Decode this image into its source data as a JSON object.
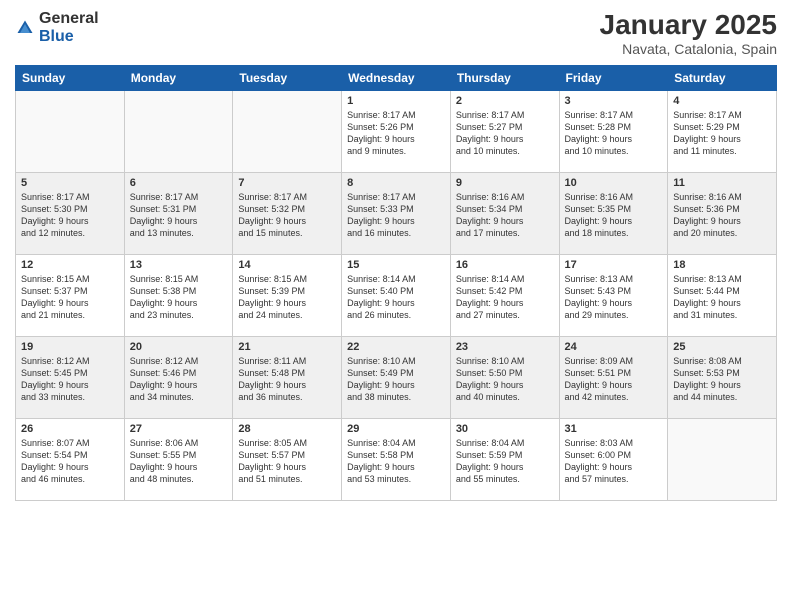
{
  "logo": {
    "general": "General",
    "blue": "Blue"
  },
  "title": "January 2025",
  "location": "Navata, Catalonia, Spain",
  "days_of_week": [
    "Sunday",
    "Monday",
    "Tuesday",
    "Wednesday",
    "Thursday",
    "Friday",
    "Saturday"
  ],
  "weeks": [
    {
      "shaded": false,
      "days": [
        {
          "num": "",
          "lines": []
        },
        {
          "num": "",
          "lines": []
        },
        {
          "num": "",
          "lines": []
        },
        {
          "num": "1",
          "lines": [
            "Sunrise: 8:17 AM",
            "Sunset: 5:26 PM",
            "Daylight: 9 hours",
            "and 9 minutes."
          ]
        },
        {
          "num": "2",
          "lines": [
            "Sunrise: 8:17 AM",
            "Sunset: 5:27 PM",
            "Daylight: 9 hours",
            "and 10 minutes."
          ]
        },
        {
          "num": "3",
          "lines": [
            "Sunrise: 8:17 AM",
            "Sunset: 5:28 PM",
            "Daylight: 9 hours",
            "and 10 minutes."
          ]
        },
        {
          "num": "4",
          "lines": [
            "Sunrise: 8:17 AM",
            "Sunset: 5:29 PM",
            "Daylight: 9 hours",
            "and 11 minutes."
          ]
        }
      ]
    },
    {
      "shaded": true,
      "days": [
        {
          "num": "5",
          "lines": [
            "Sunrise: 8:17 AM",
            "Sunset: 5:30 PM",
            "Daylight: 9 hours",
            "and 12 minutes."
          ]
        },
        {
          "num": "6",
          "lines": [
            "Sunrise: 8:17 AM",
            "Sunset: 5:31 PM",
            "Daylight: 9 hours",
            "and 13 minutes."
          ]
        },
        {
          "num": "7",
          "lines": [
            "Sunrise: 8:17 AM",
            "Sunset: 5:32 PM",
            "Daylight: 9 hours",
            "and 15 minutes."
          ]
        },
        {
          "num": "8",
          "lines": [
            "Sunrise: 8:17 AM",
            "Sunset: 5:33 PM",
            "Daylight: 9 hours",
            "and 16 minutes."
          ]
        },
        {
          "num": "9",
          "lines": [
            "Sunrise: 8:16 AM",
            "Sunset: 5:34 PM",
            "Daylight: 9 hours",
            "and 17 minutes."
          ]
        },
        {
          "num": "10",
          "lines": [
            "Sunrise: 8:16 AM",
            "Sunset: 5:35 PM",
            "Daylight: 9 hours",
            "and 18 minutes."
          ]
        },
        {
          "num": "11",
          "lines": [
            "Sunrise: 8:16 AM",
            "Sunset: 5:36 PM",
            "Daylight: 9 hours",
            "and 20 minutes."
          ]
        }
      ]
    },
    {
      "shaded": false,
      "days": [
        {
          "num": "12",
          "lines": [
            "Sunrise: 8:15 AM",
            "Sunset: 5:37 PM",
            "Daylight: 9 hours",
            "and 21 minutes."
          ]
        },
        {
          "num": "13",
          "lines": [
            "Sunrise: 8:15 AM",
            "Sunset: 5:38 PM",
            "Daylight: 9 hours",
            "and 23 minutes."
          ]
        },
        {
          "num": "14",
          "lines": [
            "Sunrise: 8:15 AM",
            "Sunset: 5:39 PM",
            "Daylight: 9 hours",
            "and 24 minutes."
          ]
        },
        {
          "num": "15",
          "lines": [
            "Sunrise: 8:14 AM",
            "Sunset: 5:40 PM",
            "Daylight: 9 hours",
            "and 26 minutes."
          ]
        },
        {
          "num": "16",
          "lines": [
            "Sunrise: 8:14 AM",
            "Sunset: 5:42 PM",
            "Daylight: 9 hours",
            "and 27 minutes."
          ]
        },
        {
          "num": "17",
          "lines": [
            "Sunrise: 8:13 AM",
            "Sunset: 5:43 PM",
            "Daylight: 9 hours",
            "and 29 minutes."
          ]
        },
        {
          "num": "18",
          "lines": [
            "Sunrise: 8:13 AM",
            "Sunset: 5:44 PM",
            "Daylight: 9 hours",
            "and 31 minutes."
          ]
        }
      ]
    },
    {
      "shaded": true,
      "days": [
        {
          "num": "19",
          "lines": [
            "Sunrise: 8:12 AM",
            "Sunset: 5:45 PM",
            "Daylight: 9 hours",
            "and 33 minutes."
          ]
        },
        {
          "num": "20",
          "lines": [
            "Sunrise: 8:12 AM",
            "Sunset: 5:46 PM",
            "Daylight: 9 hours",
            "and 34 minutes."
          ]
        },
        {
          "num": "21",
          "lines": [
            "Sunrise: 8:11 AM",
            "Sunset: 5:48 PM",
            "Daylight: 9 hours",
            "and 36 minutes."
          ]
        },
        {
          "num": "22",
          "lines": [
            "Sunrise: 8:10 AM",
            "Sunset: 5:49 PM",
            "Daylight: 9 hours",
            "and 38 minutes."
          ]
        },
        {
          "num": "23",
          "lines": [
            "Sunrise: 8:10 AM",
            "Sunset: 5:50 PM",
            "Daylight: 9 hours",
            "and 40 minutes."
          ]
        },
        {
          "num": "24",
          "lines": [
            "Sunrise: 8:09 AM",
            "Sunset: 5:51 PM",
            "Daylight: 9 hours",
            "and 42 minutes."
          ]
        },
        {
          "num": "25",
          "lines": [
            "Sunrise: 8:08 AM",
            "Sunset: 5:53 PM",
            "Daylight: 9 hours",
            "and 44 minutes."
          ]
        }
      ]
    },
    {
      "shaded": false,
      "days": [
        {
          "num": "26",
          "lines": [
            "Sunrise: 8:07 AM",
            "Sunset: 5:54 PM",
            "Daylight: 9 hours",
            "and 46 minutes."
          ]
        },
        {
          "num": "27",
          "lines": [
            "Sunrise: 8:06 AM",
            "Sunset: 5:55 PM",
            "Daylight: 9 hours",
            "and 48 minutes."
          ]
        },
        {
          "num": "28",
          "lines": [
            "Sunrise: 8:05 AM",
            "Sunset: 5:57 PM",
            "Daylight: 9 hours",
            "and 51 minutes."
          ]
        },
        {
          "num": "29",
          "lines": [
            "Sunrise: 8:04 AM",
            "Sunset: 5:58 PM",
            "Daylight: 9 hours",
            "and 53 minutes."
          ]
        },
        {
          "num": "30",
          "lines": [
            "Sunrise: 8:04 AM",
            "Sunset: 5:59 PM",
            "Daylight: 9 hours",
            "and 55 minutes."
          ]
        },
        {
          "num": "31",
          "lines": [
            "Sunrise: 8:03 AM",
            "Sunset: 6:00 PM",
            "Daylight: 9 hours",
            "and 57 minutes."
          ]
        },
        {
          "num": "",
          "lines": []
        }
      ]
    }
  ]
}
